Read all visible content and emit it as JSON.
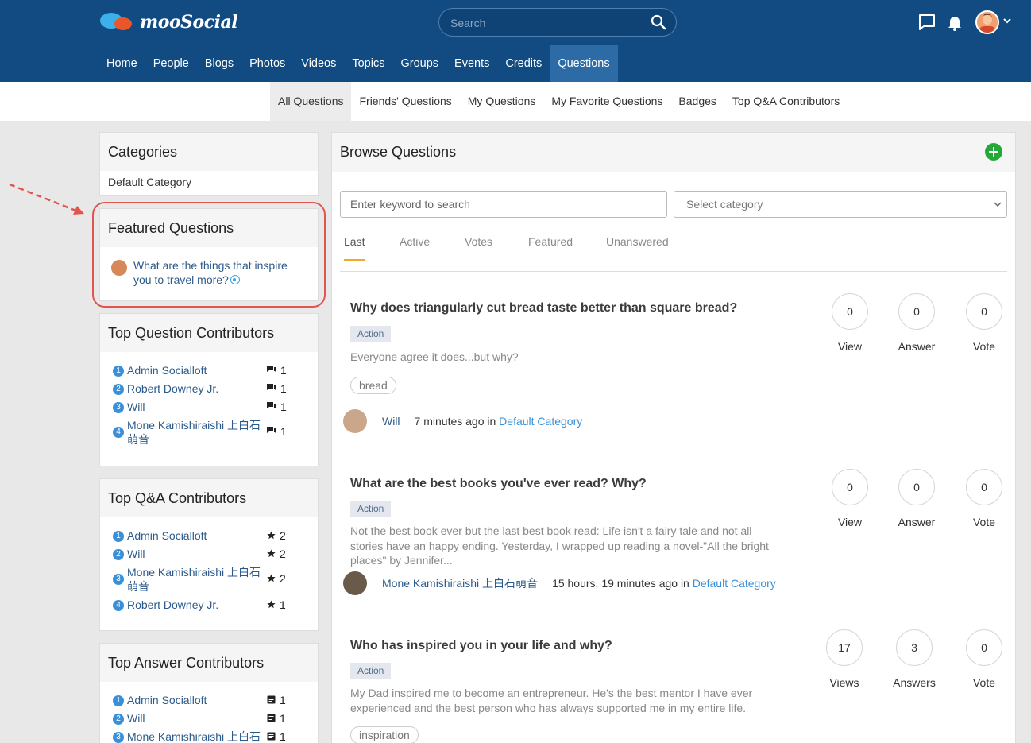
{
  "header": {
    "logo_text": "mooSocial",
    "search_placeholder": "Search"
  },
  "nav": {
    "items": [
      "Home",
      "People",
      "Blogs",
      "Photos",
      "Videos",
      "Topics",
      "Groups",
      "Events",
      "Credits",
      "Questions"
    ],
    "active": "Questions"
  },
  "subnav": {
    "items": [
      "All Questions",
      "Friends' Questions",
      "My Questions",
      "My Favorite Questions",
      "Badges",
      "Top Q&A Contributors"
    ],
    "active": "All Questions"
  },
  "sidebar": {
    "categories": {
      "title": "Categories",
      "items": [
        "Default Category"
      ]
    },
    "featured": {
      "title": "Featured Questions",
      "items": [
        {
          "text": "What are the things that inspire you to travel more?"
        }
      ]
    },
    "top_question": {
      "title": "Top Question Contributors",
      "items": [
        {
          "rank": "1",
          "name": "Admin Socialloft",
          "count": "1"
        },
        {
          "rank": "2",
          "name": "Robert Downey Jr.",
          "count": "1"
        },
        {
          "rank": "3",
          "name": "Will",
          "count": "1"
        },
        {
          "rank": "4",
          "name": "Mone Kamishiraishi 上白石萌音",
          "count": "1"
        }
      ]
    },
    "top_qa": {
      "title": "Top Q&A Contributors",
      "items": [
        {
          "rank": "1",
          "name": "Admin Socialloft",
          "count": "2"
        },
        {
          "rank": "2",
          "name": "Will",
          "count": "2"
        },
        {
          "rank": "3",
          "name": "Mone Kamishiraishi 上白石萌音",
          "count": "2"
        },
        {
          "rank": "4",
          "name": "Robert Downey Jr.",
          "count": "1"
        }
      ]
    },
    "top_answer": {
      "title": "Top Answer Contributors",
      "items": [
        {
          "rank": "1",
          "name": "Admin Socialloft",
          "count": "1"
        },
        {
          "rank": "2",
          "name": "Will",
          "count": "1"
        },
        {
          "rank": "3",
          "name": "Mone Kamishiraishi 上白石",
          "count": "1"
        }
      ]
    }
  },
  "main": {
    "title": "Browse Questions",
    "keyword_placeholder": "Enter keyword to search",
    "category_select": "Select category",
    "tabs": [
      "Last",
      "Active",
      "Votes",
      "Featured",
      "Unanswered"
    ],
    "active_tab": "Last",
    "questions": [
      {
        "title": "Why does triangularly cut bread taste better than square bread?",
        "badge": "Action",
        "excerpt": "Everyone agree it does...but why?",
        "tag": "bread",
        "author": "Will",
        "time": "7 minutes ago in",
        "category": "Default Category",
        "stats": [
          {
            "value": "0",
            "label": "View"
          },
          {
            "value": "0",
            "label": "Answer"
          },
          {
            "value": "0",
            "label": "Vote"
          }
        ]
      },
      {
        "title": "What are the best books you've ever read? Why?",
        "badge": "Action",
        "excerpt": "Not the best book ever but the last best book read: Life isn't a fairy tale and not all stories have an happy ending. Yesterday, I wrapped up reading a novel-\"All the bright places\" by Jennifer...",
        "author": "Mone Kamishiraishi 上白石萌音",
        "time": "15 hours, 19 minutes ago in",
        "category": "Default Category",
        "stats": [
          {
            "value": "0",
            "label": "View"
          },
          {
            "value": "0",
            "label": "Answer"
          },
          {
            "value": "0",
            "label": "Vote"
          }
        ]
      },
      {
        "title": "Who has inspired you in your life and why?",
        "badge": "Action",
        "excerpt": "My Dad inspired me to become an entrepreneur. He's the best mentor I have ever experienced and the best person who has always supported me in my entire life.",
        "tag": "inspiration",
        "stats": [
          {
            "value": "17",
            "label": "Views"
          },
          {
            "value": "3",
            "label": "Answers"
          },
          {
            "value": "0",
            "label": "Vote"
          }
        ]
      }
    ]
  },
  "colors": {
    "header_bg": "#114b82",
    "nav_active": "#2d6ba6",
    "link": "#2c5a8b",
    "accent_underline": "#f0a830",
    "add_button": "#24a838",
    "highlight": "#e0554f"
  }
}
